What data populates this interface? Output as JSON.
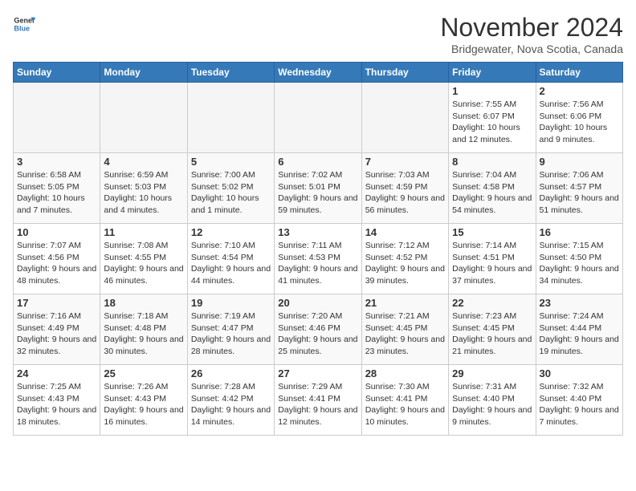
{
  "header": {
    "logo_line1": "General",
    "logo_line2": "Blue",
    "month": "November 2024",
    "location": "Bridgewater, Nova Scotia, Canada"
  },
  "weekdays": [
    "Sunday",
    "Monday",
    "Tuesday",
    "Wednesday",
    "Thursday",
    "Friday",
    "Saturday"
  ],
  "weeks": [
    [
      {
        "day": "",
        "info": ""
      },
      {
        "day": "",
        "info": ""
      },
      {
        "day": "",
        "info": ""
      },
      {
        "day": "",
        "info": ""
      },
      {
        "day": "",
        "info": ""
      },
      {
        "day": "1",
        "info": "Sunrise: 7:55 AM\nSunset: 6:07 PM\nDaylight: 10 hours and 12 minutes."
      },
      {
        "day": "2",
        "info": "Sunrise: 7:56 AM\nSunset: 6:06 PM\nDaylight: 10 hours and 9 minutes."
      }
    ],
    [
      {
        "day": "3",
        "info": "Sunrise: 6:58 AM\nSunset: 5:05 PM\nDaylight: 10 hours and 7 minutes."
      },
      {
        "day": "4",
        "info": "Sunrise: 6:59 AM\nSunset: 5:03 PM\nDaylight: 10 hours and 4 minutes."
      },
      {
        "day": "5",
        "info": "Sunrise: 7:00 AM\nSunset: 5:02 PM\nDaylight: 10 hours and 1 minute."
      },
      {
        "day": "6",
        "info": "Sunrise: 7:02 AM\nSunset: 5:01 PM\nDaylight: 9 hours and 59 minutes."
      },
      {
        "day": "7",
        "info": "Sunrise: 7:03 AM\nSunset: 4:59 PM\nDaylight: 9 hours and 56 minutes."
      },
      {
        "day": "8",
        "info": "Sunrise: 7:04 AM\nSunset: 4:58 PM\nDaylight: 9 hours and 54 minutes."
      },
      {
        "day": "9",
        "info": "Sunrise: 7:06 AM\nSunset: 4:57 PM\nDaylight: 9 hours and 51 minutes."
      }
    ],
    [
      {
        "day": "10",
        "info": "Sunrise: 7:07 AM\nSunset: 4:56 PM\nDaylight: 9 hours and 48 minutes."
      },
      {
        "day": "11",
        "info": "Sunrise: 7:08 AM\nSunset: 4:55 PM\nDaylight: 9 hours and 46 minutes."
      },
      {
        "day": "12",
        "info": "Sunrise: 7:10 AM\nSunset: 4:54 PM\nDaylight: 9 hours and 44 minutes."
      },
      {
        "day": "13",
        "info": "Sunrise: 7:11 AM\nSunset: 4:53 PM\nDaylight: 9 hours and 41 minutes."
      },
      {
        "day": "14",
        "info": "Sunrise: 7:12 AM\nSunset: 4:52 PM\nDaylight: 9 hours and 39 minutes."
      },
      {
        "day": "15",
        "info": "Sunrise: 7:14 AM\nSunset: 4:51 PM\nDaylight: 9 hours and 37 minutes."
      },
      {
        "day": "16",
        "info": "Sunrise: 7:15 AM\nSunset: 4:50 PM\nDaylight: 9 hours and 34 minutes."
      }
    ],
    [
      {
        "day": "17",
        "info": "Sunrise: 7:16 AM\nSunset: 4:49 PM\nDaylight: 9 hours and 32 minutes."
      },
      {
        "day": "18",
        "info": "Sunrise: 7:18 AM\nSunset: 4:48 PM\nDaylight: 9 hours and 30 minutes."
      },
      {
        "day": "19",
        "info": "Sunrise: 7:19 AM\nSunset: 4:47 PM\nDaylight: 9 hours and 28 minutes."
      },
      {
        "day": "20",
        "info": "Sunrise: 7:20 AM\nSunset: 4:46 PM\nDaylight: 9 hours and 25 minutes."
      },
      {
        "day": "21",
        "info": "Sunrise: 7:21 AM\nSunset: 4:45 PM\nDaylight: 9 hours and 23 minutes."
      },
      {
        "day": "22",
        "info": "Sunrise: 7:23 AM\nSunset: 4:45 PM\nDaylight: 9 hours and 21 minutes."
      },
      {
        "day": "23",
        "info": "Sunrise: 7:24 AM\nSunset: 4:44 PM\nDaylight: 9 hours and 19 minutes."
      }
    ],
    [
      {
        "day": "24",
        "info": "Sunrise: 7:25 AM\nSunset: 4:43 PM\nDaylight: 9 hours and 18 minutes."
      },
      {
        "day": "25",
        "info": "Sunrise: 7:26 AM\nSunset: 4:43 PM\nDaylight: 9 hours and 16 minutes."
      },
      {
        "day": "26",
        "info": "Sunrise: 7:28 AM\nSunset: 4:42 PM\nDaylight: 9 hours and 14 minutes."
      },
      {
        "day": "27",
        "info": "Sunrise: 7:29 AM\nSunset: 4:41 PM\nDaylight: 9 hours and 12 minutes."
      },
      {
        "day": "28",
        "info": "Sunrise: 7:30 AM\nSunset: 4:41 PM\nDaylight: 9 hours and 10 minutes."
      },
      {
        "day": "29",
        "info": "Sunrise: 7:31 AM\nSunset: 4:40 PM\nDaylight: 9 hours and 9 minutes."
      },
      {
        "day": "30",
        "info": "Sunrise: 7:32 AM\nSunset: 4:40 PM\nDaylight: 9 hours and 7 minutes."
      }
    ]
  ]
}
